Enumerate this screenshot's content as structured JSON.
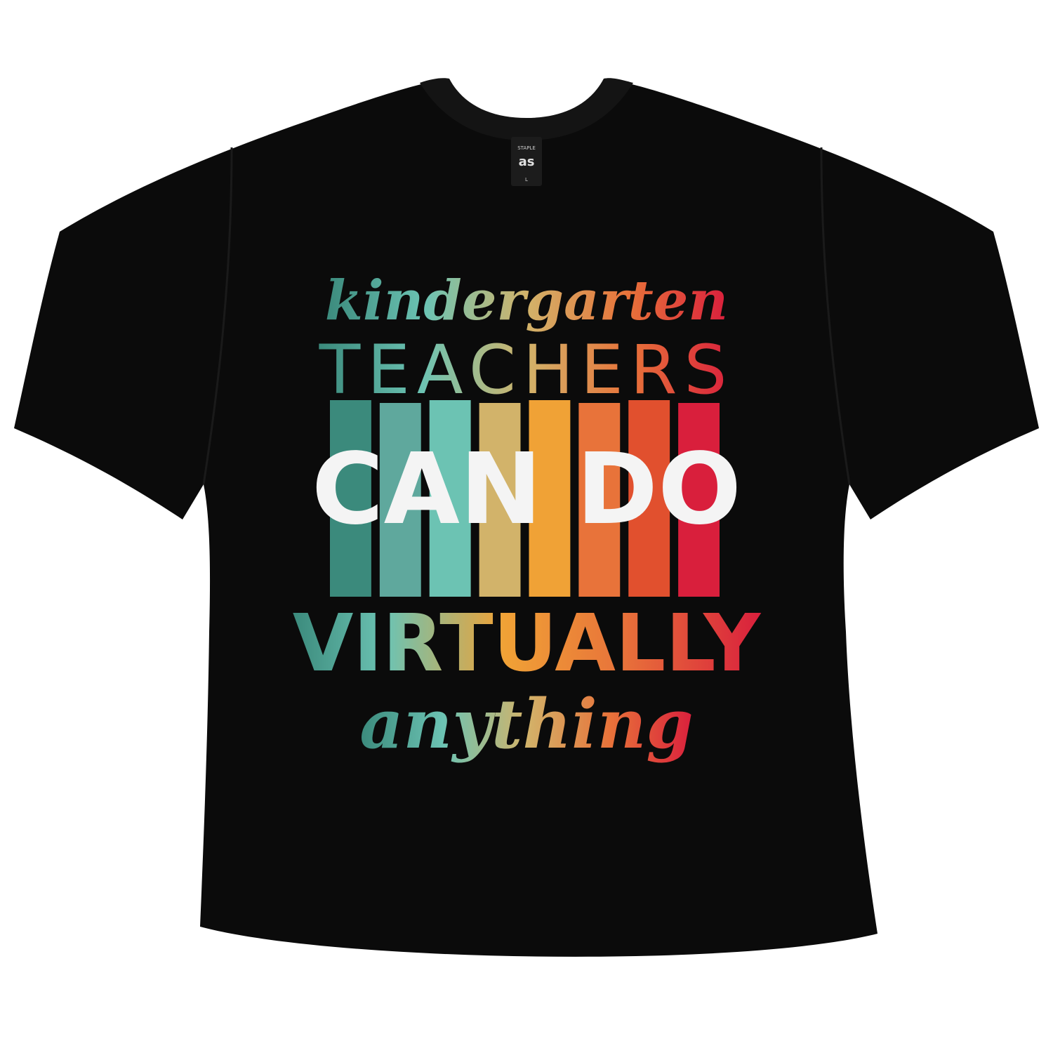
{
  "design": {
    "line1": "kindergarten",
    "line2": "TEACHERS",
    "line3": "CAN DO",
    "line4": "VIRTUALLY",
    "line5": "anything"
  },
  "label": {
    "line_top": "STAPLE",
    "line_bottom": "L"
  },
  "colors": {
    "shirt": "#0b0b0b",
    "shirt_shadow": "#050505",
    "ink_white": "#f4f4f4",
    "palette": [
      "#3b8a7c",
      "#5fa89d",
      "#6cc3b3",
      "#d2b36a",
      "#f0a236",
      "#e8733a",
      "#e1502e",
      "#d91f3c"
    ]
  }
}
